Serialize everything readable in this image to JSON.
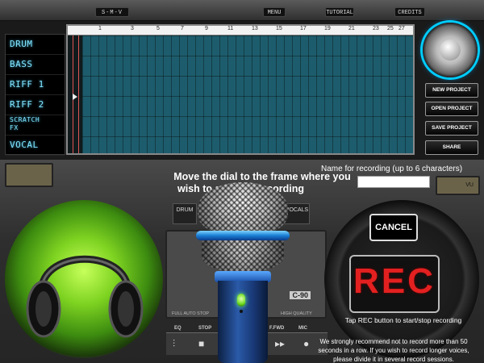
{
  "topbar": {
    "logo": "S-M-V",
    "menu": "MENU",
    "tutorial": "TUTORIAL",
    "credits": "CREDITS"
  },
  "tracks": [
    "DRUM",
    "BASS",
    "RIFF 1",
    "RIFF 2",
    "SCRATCH FX",
    "VOCAL"
  ],
  "ruler": [
    "1",
    "3",
    "5",
    "7",
    "9",
    "11",
    "13",
    "15",
    "17",
    "19",
    "21",
    "23",
    "25",
    "27"
  ],
  "project_buttons": {
    "new": "NEW PROJECT",
    "open": "OPEN PROJECT",
    "save": "SAVE PROJECT",
    "share": "SHARE"
  },
  "recording": {
    "instruction_line1": "Move the dial to the frame where you",
    "instruction_line2": "wish to start the recording",
    "name_label": "Name for recording (up to 6 characters)",
    "name_value": "",
    "cancel": "CANCEL",
    "rec": "REC",
    "tap_hint": "Tap REC button to start/stop recording",
    "warning": "We strongly recommend not to record more than 50 seconds in a row. If you wish to record longer voices, please divide it in several record sessions."
  },
  "device": {
    "drum": "DRUM",
    "vocals": "VOCALS",
    "tape": "C-90",
    "full_auto_stop": "FULL AUTO STOP",
    "high_quality": "HIGH QUALITY",
    "vu": "VU",
    "eq": "EQ",
    "stop": "STOP",
    "ffwd": "F.FWD",
    "mic": "MIC"
  },
  "colors": {
    "accent_cyan": "#7fe5ff",
    "grid_teal": "#1d5c6c",
    "rec_red": "#e32020",
    "speaker_green": "#7ed321"
  }
}
